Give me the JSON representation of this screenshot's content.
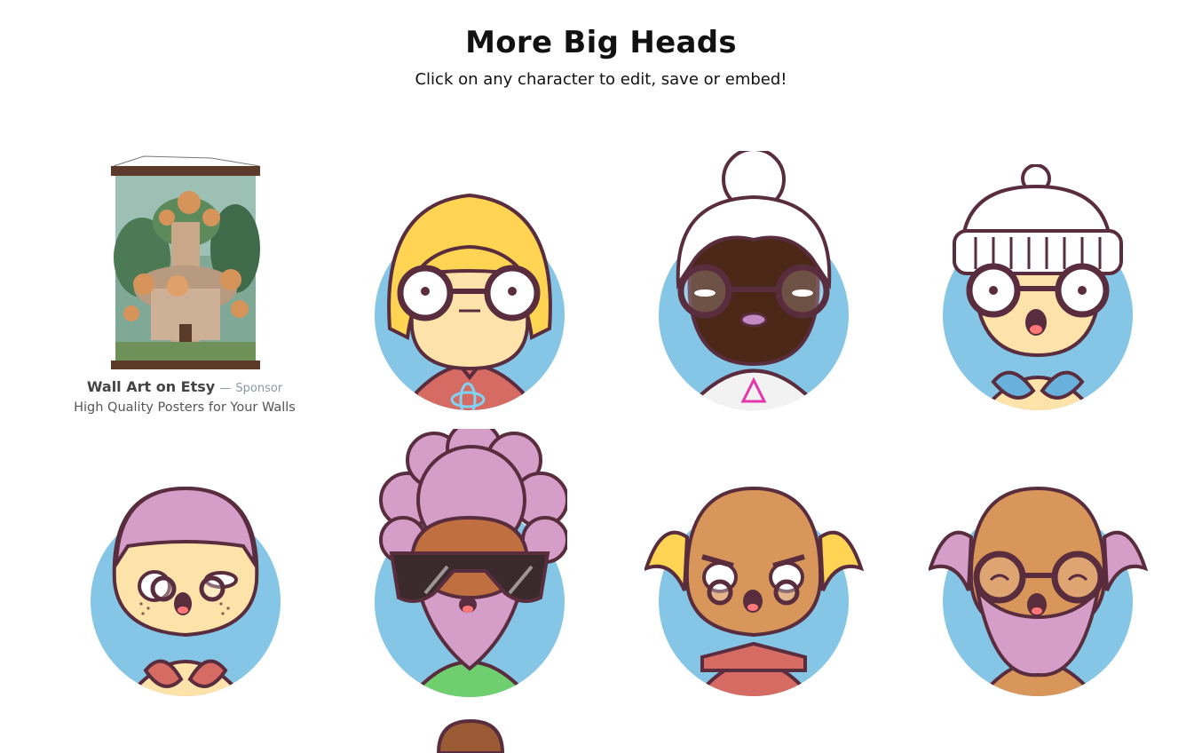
{
  "header": {
    "title": "More Big Heads",
    "subtitle": "Click on any character to edit, save or embed!"
  },
  "sponsor": {
    "name": "Wall Art on Etsy",
    "dash": "—",
    "tag": "Sponsor",
    "description": "High Quality Posters for Your Walls"
  },
  "colors": {
    "background_circle": "#85c5e5",
    "outline": "#592d3d"
  },
  "characters": [
    {
      "name": "yellow-bob-hair-glasses-react-shirt"
    },
    {
      "name": "white-bun-hair-dark-skin-graphql-shirt"
    },
    {
      "name": "beanie-surprised-bikini"
    },
    {
      "name": "pink-hair-freckles-bikini"
    },
    {
      "name": "afro-sunglasses-pink-beard"
    },
    {
      "name": "bald-angry-yellow-sides"
    },
    {
      "name": "bald-pink-beard-glasses"
    },
    {
      "name": "partially-visible-character"
    }
  ]
}
